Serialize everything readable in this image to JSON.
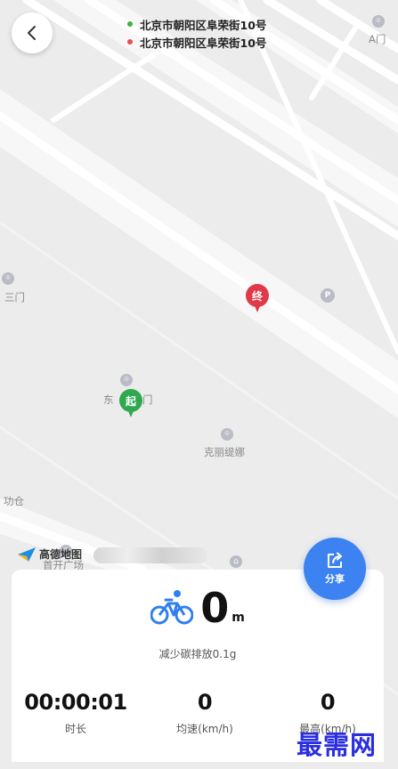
{
  "route": {
    "start_address": "北京市朝阳区阜荣街10号",
    "end_address": "北京市朝阳区阜荣街10号",
    "start_color": "#3cb33c",
    "end_color": "#e55050"
  },
  "map": {
    "labels": {
      "a_gate": "A门",
      "third_gate": "三门",
      "east_gate_left": "东",
      "east_gate_right": "门",
      "kelitina": "克丽缇娜",
      "warehouse": "功仓",
      "square": "首开广场"
    },
    "pins": {
      "start": "起",
      "end": "终"
    },
    "poi_parking": "P",
    "logo_text": "高德地图"
  },
  "share": {
    "label": "分享",
    "color": "#3c82f0"
  },
  "summary": {
    "distance_value": "0",
    "distance_unit": "m",
    "carbon_text": "减少碳排放0.1g",
    "stats": [
      {
        "value": "00:00:01",
        "label": "时长"
      },
      {
        "value": "0",
        "label": "均速(km/h)"
      },
      {
        "value": "0",
        "label": "最高(km/h)"
      }
    ]
  },
  "watermark": "最需网",
  "icons": {
    "back": "chevron-left-icon",
    "share": "share-icon",
    "bicycle": "bicycle-icon"
  }
}
